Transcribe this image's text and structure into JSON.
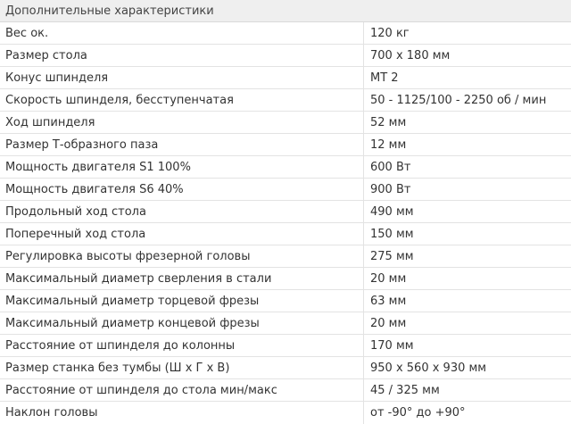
{
  "table": {
    "title": "Дополнительные характеристики",
    "rows": [
      {
        "name": "Вес ок.",
        "value": "120 кг"
      },
      {
        "name": "Размер стола",
        "value": "700 x 180 мм"
      },
      {
        "name": "Конус шпинделя",
        "value": "MT 2"
      },
      {
        "name": "Скорость шпинделя, бесступенчатая",
        "value": "50 - 1125/100 - 2250 об / мин"
      },
      {
        "name": "Ход шпинделя",
        "value": "52 мм"
      },
      {
        "name": "Размер Т-образного паза",
        "value": "12 мм"
      },
      {
        "name": "Мощность двигателя S1 100%",
        "value": "600 Вт"
      },
      {
        "name": "Мощность двигателя S6 40%",
        "value": "900 Вт"
      },
      {
        "name": "Продольный ход стола",
        "value": "490 мм"
      },
      {
        "name": "Поперечный ход стола",
        "value": "150 мм"
      },
      {
        "name": "Регулировка высоты фрезерной головы",
        "value": "275 мм"
      },
      {
        "name": "Максимальный диаметр сверления в стали",
        "value": "20 мм"
      },
      {
        "name": "Максимальный диаметр торцевой фрезы",
        "value": "63 мм"
      },
      {
        "name": "Максимальный диаметр концевой фрезы",
        "value": "20 мм"
      },
      {
        "name": "Расстояние от шпинделя до колонны",
        "value": "170 мм"
      },
      {
        "name": "Размер станка без тумбы (Ш x Г x В)",
        "value": "950 x 560 x 930 мм"
      },
      {
        "name": "Расстояние от шпинделя до стола мин/макс",
        "value": "45 / 325 мм"
      },
      {
        "name": "Наклон головы",
        "value": "от -90° до +90°"
      }
    ]
  }
}
